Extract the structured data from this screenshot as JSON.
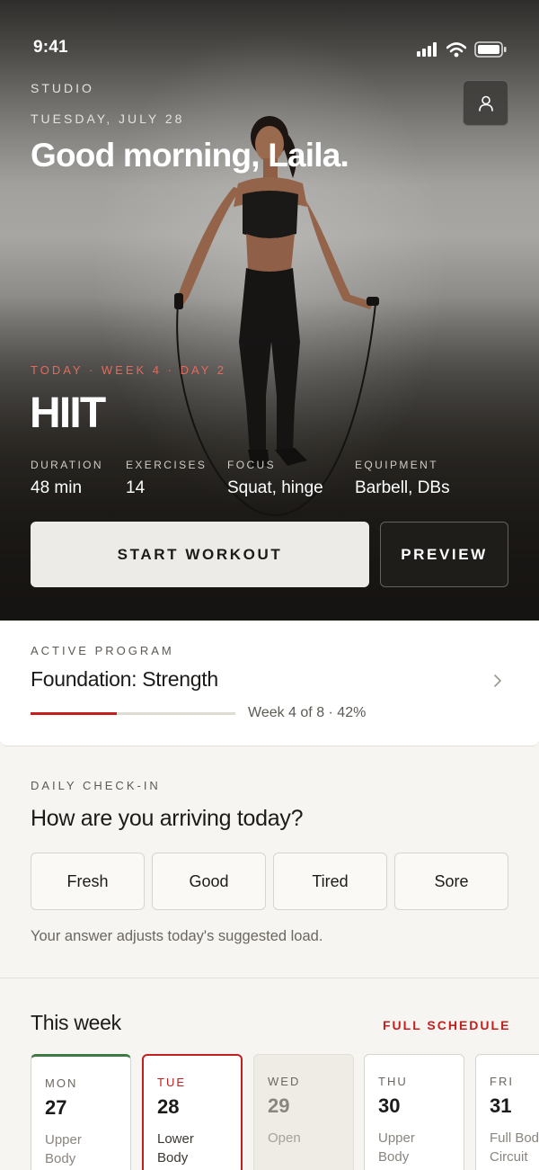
{
  "status_bar": {
    "time": "9:41"
  },
  "hero": {
    "eyebrow": "STUDIO",
    "date": "TUESDAY, JULY 28",
    "greeting": "Good morning, Laila.",
    "today_label": "TODAY · WEEK 4 · DAY 2",
    "workout_title": "HIIT",
    "meta": [
      {
        "label": "DURATION",
        "value": "48 min"
      },
      {
        "label": "EXERCISES",
        "value": "14"
      },
      {
        "label": "FOCUS",
        "value": "Squat, hinge"
      },
      {
        "label": "EQUIPMENT",
        "value": "Barbell, DBs"
      }
    ],
    "start_label": "START WORKOUT",
    "preview_label": "PREVIEW",
    "profile_icon": "user-icon"
  },
  "program": {
    "section_label": "ACTIVE PROGRAM",
    "name": "Foundation: Strength",
    "progress_fraction": 0.42,
    "progress_text": "Week 4 of 8 · 42%"
  },
  "checkin": {
    "section_label": "DAILY CHECK-IN",
    "question": "How are you arriving today?",
    "options": [
      "Fresh",
      "Good",
      "Tired",
      "Sore"
    ],
    "note": "Your answer adjusts today's suggested load."
  },
  "week": {
    "title": "This week",
    "full_schedule_label": "FULL SCHEDULE",
    "days": [
      {
        "name": "MON",
        "num": "27",
        "desc": "Upper\nBody",
        "state": "done"
      },
      {
        "name": "TUE",
        "num": "28",
        "desc": "Lower\nBody",
        "state": "today"
      },
      {
        "name": "WED",
        "num": "29",
        "desc": "Open",
        "state": "rest"
      },
      {
        "name": "THU",
        "num": "30",
        "desc": "Upper\nBody",
        "state": "upcoming"
      },
      {
        "name": "FRI",
        "num": "31",
        "desc": "Full Body\nCircuit",
        "state": "upcoming"
      }
    ]
  },
  "colors": {
    "accent": "#c21f1f",
    "done": "#3f7a45",
    "today_label": "#e46a5d"
  }
}
